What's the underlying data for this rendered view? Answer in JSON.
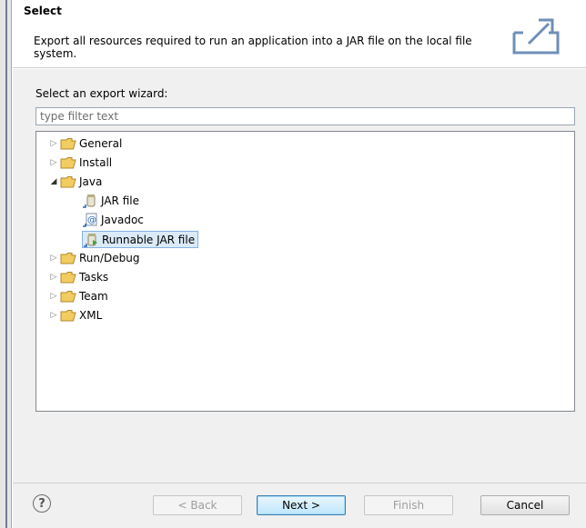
{
  "header": {
    "title": "Select",
    "description": "Export all resources required to run an application into a JAR file on the local file system."
  },
  "wizard": {
    "section_label": "Select an export wizard:",
    "filter_placeholder": "type filter text"
  },
  "tree": {
    "items": [
      {
        "label": "General",
        "icon": "folder-icon",
        "expanded": false
      },
      {
        "label": "Install",
        "icon": "folder-icon",
        "expanded": false
      },
      {
        "label": "Java",
        "icon": "folder-icon",
        "expanded": true
      },
      {
        "label": "JAR file",
        "icon": "jar-file-icon",
        "child": true
      },
      {
        "label": "Javadoc",
        "icon": "javadoc-icon",
        "child": true
      },
      {
        "label": "Runnable JAR file",
        "icon": "runnable-jar-icon",
        "child": true,
        "selected": true
      },
      {
        "label": "Run/Debug",
        "icon": "folder-icon",
        "expanded": false
      },
      {
        "label": "Tasks",
        "icon": "folder-icon",
        "expanded": false
      },
      {
        "label": "Team",
        "icon": "folder-icon",
        "expanded": false
      },
      {
        "label": "XML",
        "icon": "folder-icon",
        "expanded": false
      }
    ]
  },
  "buttons": {
    "help": "?",
    "back": "< Back",
    "next": "Next >",
    "finish": "Finish",
    "cancel": "Cancel"
  },
  "colors": {
    "selection_bg": "#dbeaf9",
    "selection_border": "#83b3e2",
    "folder": "#f3cc61",
    "default_button_border": "#3c7fb1"
  }
}
